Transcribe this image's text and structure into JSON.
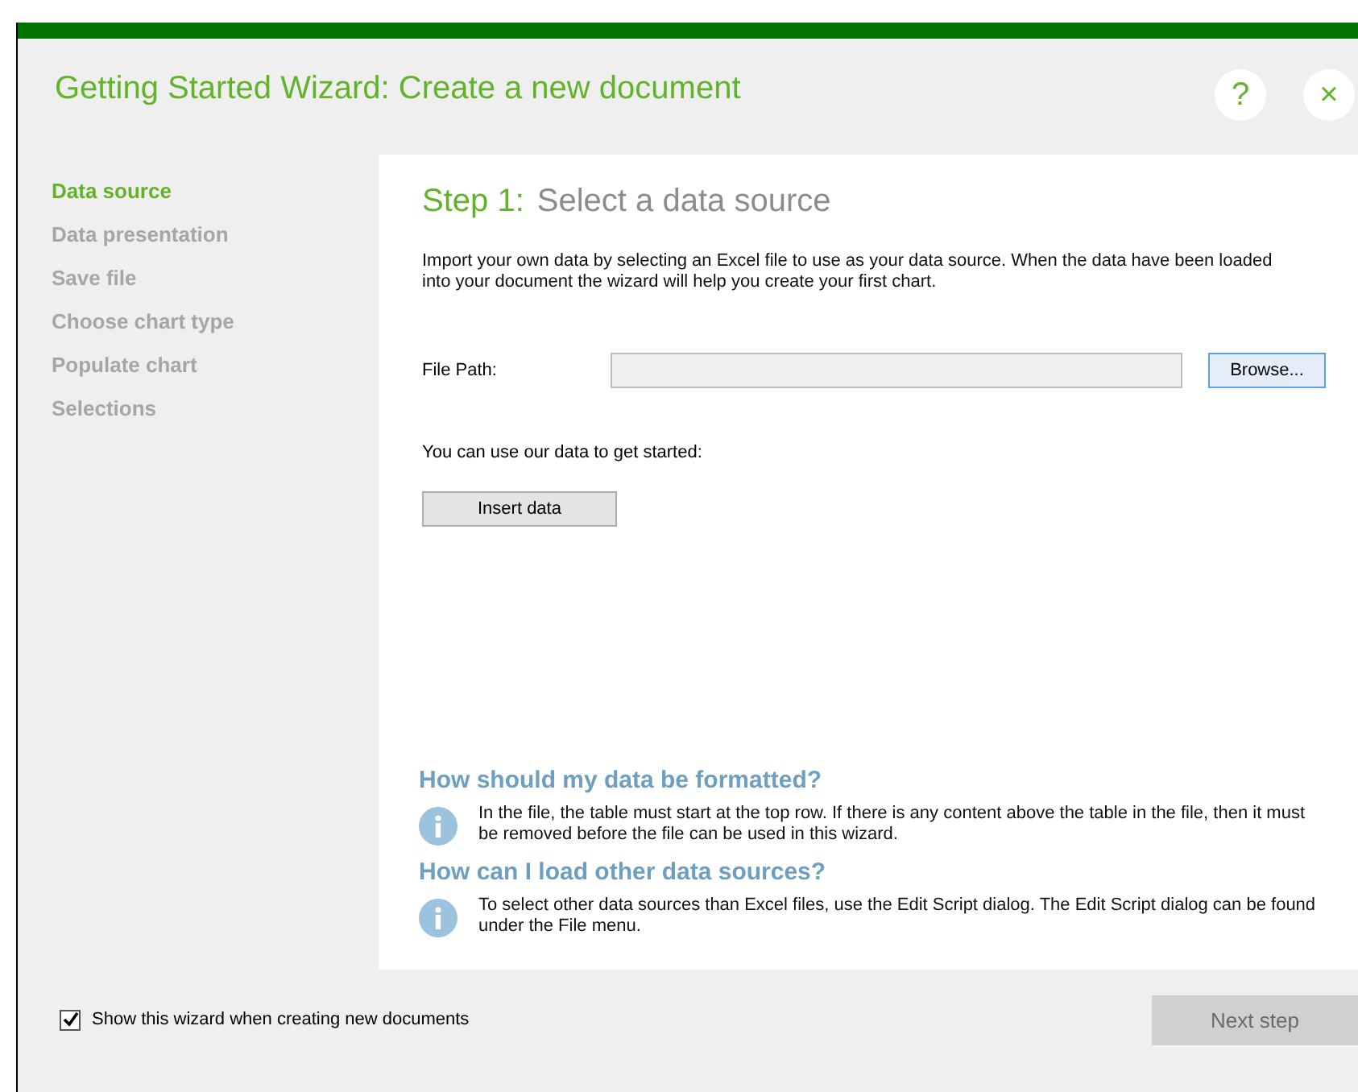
{
  "window": {
    "title": "Getting Started Wizard: Create a new document",
    "help": "?",
    "close": "×"
  },
  "steps": [
    {
      "label": "Data source",
      "selected": true
    },
    {
      "label": "Data presentation",
      "selected": false
    },
    {
      "label": "Save file",
      "selected": false
    },
    {
      "label": "Choose chart type",
      "selected": false
    },
    {
      "label": "Populate chart",
      "selected": false
    },
    {
      "label": "Selections",
      "selected": false
    }
  ],
  "page": {
    "step_label": "Step 1:",
    "step_title": "Select a data source",
    "intro": "Import your own data by selecting an Excel file to use as your data source. When the data have been loaded into your document the wizard will help you create your first chart.",
    "file_path": {
      "label": "File Path:",
      "browse": "Browse..."
    },
    "sample": {
      "text": "You can use our data to get started:",
      "button": "Insert data"
    },
    "help": [
      {
        "question": "How should my data be formatted?",
        "answer": "In the file, the table must start at the top row. If there is any content above the table in the file, then it must be removed before the file can be used in this wizard."
      },
      {
        "question": "How can I load other data sources?",
        "answer": "To select other data sources than Excel files, use the Edit Script dialog. The Edit Script dialog can be found under the File menu."
      }
    ]
  },
  "footer": {
    "show_wizard": {
      "label": "Show this wizard when creating new documents",
      "checked": true
    },
    "next": {
      "label": "Next step",
      "disabled": true
    }
  }
}
